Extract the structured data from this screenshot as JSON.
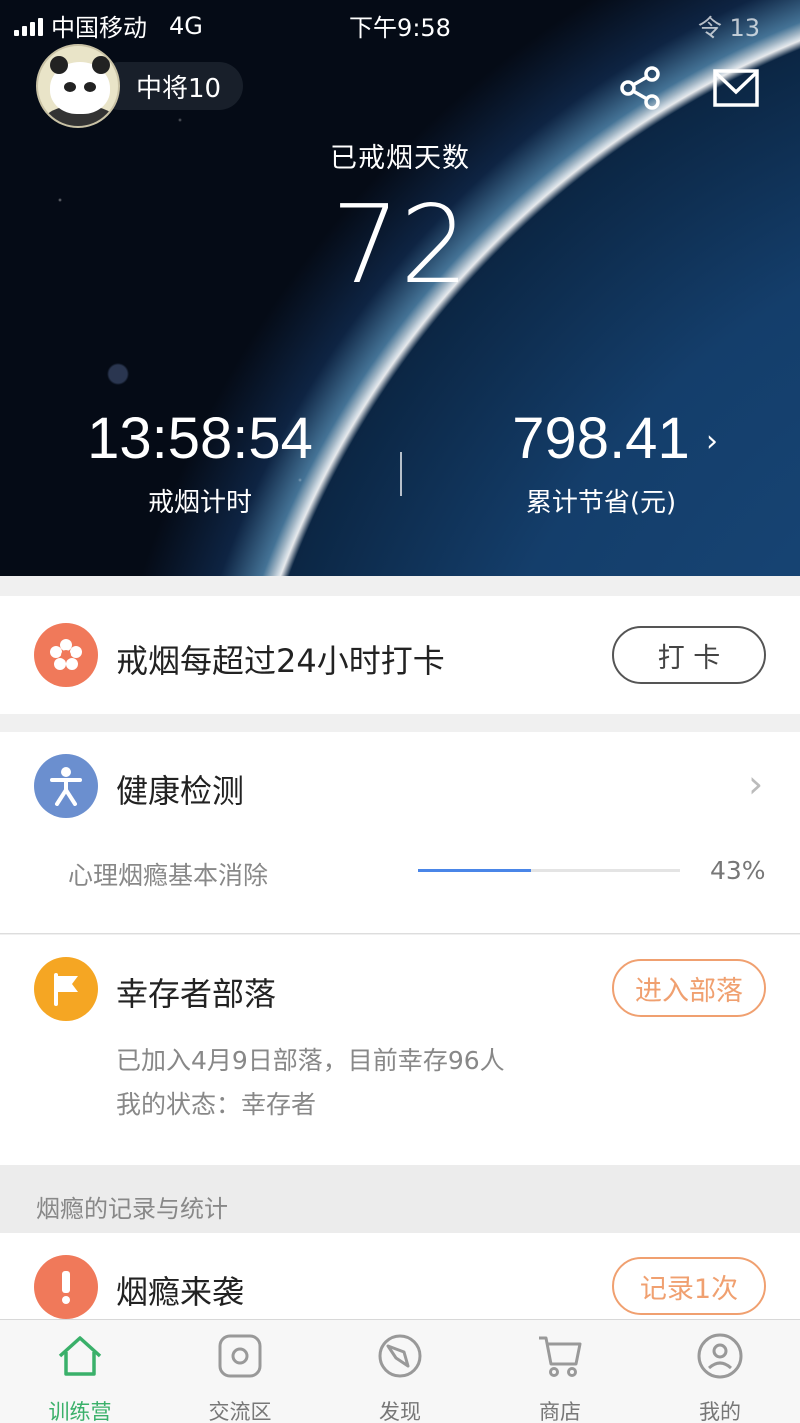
{
  "status_bar": {
    "carrier": "中国移动",
    "network": "4G",
    "time": "下午9:58",
    "right": "令 13"
  },
  "profile": {
    "nickname": "中将10"
  },
  "hero": {
    "days_label": "已戒烟天数",
    "days": "72",
    "timer_value": "13:58:54",
    "timer_label": "戒烟计时",
    "saved_value": "798.41",
    "saved_label": "累计节省(元)",
    "saved_chevron": "›"
  },
  "checkin": {
    "title": "戒烟每超过24小时打卡",
    "button": "打 卡",
    "icon_color": "#f0795a"
  },
  "health": {
    "title": "健康检测",
    "chevron": "›",
    "item_label": "心理烟瘾基本消除",
    "progress": 0.43,
    "progress_text": "43%",
    "icon_color": "#6b8fcf"
  },
  "tribe": {
    "title": "幸存者部落",
    "button": "进入部落",
    "line1": "已加入4月9日部落，目前幸存96人",
    "line2": "我的状态：幸存者",
    "icon_color": "#f5a623"
  },
  "section": {
    "title": "烟瘾的记录与统计"
  },
  "craving": {
    "title": "烟瘾来袭",
    "button": "记录1次",
    "icon_color": "#f0795a"
  },
  "colors": {
    "accent_orange": "#f0a070",
    "tab_active": "#3ab06a",
    "progress": "#4a86e8"
  },
  "tabs": [
    {
      "label": "训练营",
      "icon": "home-icon",
      "active": true
    },
    {
      "label": "交流区",
      "icon": "chat-icon",
      "active": false
    },
    {
      "label": "发现",
      "icon": "compass-icon",
      "active": false
    },
    {
      "label": "商店",
      "icon": "cart-icon",
      "active": false
    },
    {
      "label": "我的",
      "icon": "user-icon",
      "active": false
    }
  ]
}
